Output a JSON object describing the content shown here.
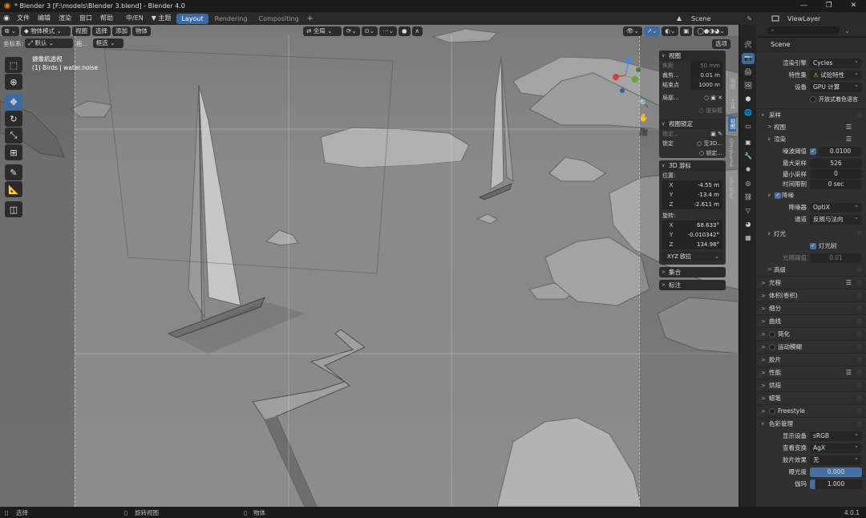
{
  "titlebar": {
    "title": "* Blender 3 [F:\\models\\Blender 3.blend] - Blender 4.0",
    "controls": [
      "—",
      "❐",
      "✕"
    ]
  },
  "menubar": {
    "items": [
      "文件",
      "编辑",
      "渲染",
      "窗口",
      "帮助",
      "中/EN",
      "▼ 主题"
    ],
    "workspaces": [
      "Layout",
      "Rendering",
      "Compositing"
    ],
    "add": "+",
    "scene": "Scene",
    "view_layer": "ViewLayer"
  },
  "viewport": {
    "header": {
      "mode": "物体模式",
      "menus": [
        "视图",
        "选择",
        "添加",
        "物体"
      ],
      "transform": "全局",
      "options": "选项"
    },
    "subheader": {
      "coord_label": "坐标系:",
      "coord_value": "默认",
      "drag_label": "拖...",
      "drag_value": "框选"
    },
    "info_line1": "摄像机透视",
    "info_line2": "(1) Birds | water.noise"
  },
  "npanel": {
    "view": {
      "title": "视图",
      "focal_label": "焦距",
      "focal_value": "50 mm",
      "clip_start_label": "裁剪...",
      "clip_start_value": "0.01 m",
      "clip_end_label": "结束点",
      "clip_end_value": "1000 m",
      "local_label": "局部...",
      "render_region": "渲染框"
    },
    "view_lock": {
      "title": "视图锁定",
      "lock_obj_label": "锁定...",
      "lock_label": "锁定",
      "to_3d": "至3D...",
      "lock2": "锁定..."
    },
    "cursor": {
      "title": "3D 游标",
      "location_label": "位置:",
      "loc": [
        {
          "axis": "X",
          "value": "-4.55 m"
        },
        {
          "axis": "Y",
          "value": "-13.4 m"
        },
        {
          "axis": "Z",
          "value": "-2.611 m"
        }
      ],
      "rotation_label": "旋转:",
      "rot": [
        {
          "axis": "X",
          "value": "68.633°"
        },
        {
          "axis": "Y",
          "value": "-0.010342°"
        },
        {
          "axis": "Z",
          "value": "134.98°"
        }
      ],
      "rotation_mode": "XYZ 欧拉"
    },
    "collections": "集合",
    "annotations": "标注"
  },
  "sidebar_tabs": [
    "视图",
    "工具",
    "视图",
    "Omniverse",
    "GScatter"
  ],
  "properties": {
    "scene_name": "Scene",
    "render_engine_label": "渲染引擎",
    "render_engine": "Cycles",
    "feature_set_label": "特性集",
    "feature_set": "试验特性",
    "device_label": "设备",
    "device": "GPU 计算",
    "osl_label": "开放式着色语言",
    "sampling": "采样",
    "viewport": "视图",
    "render": "渲染",
    "noise_threshold_label": "噪波阈值",
    "noise_threshold": "0.0100",
    "max_samples_label": "最大采样",
    "max_samples": "526",
    "min_samples_label": "最小采样",
    "min_samples": "0",
    "time_limit_label": "时间限制",
    "time_limit": "0 sec",
    "denoise": "降噪",
    "denoiser_label": "降噪器",
    "denoiser": "OptiX",
    "passes_label": "通道",
    "passes": "反照与法向",
    "lights": "灯光",
    "light_tree": "灯光树",
    "light_threshold_label": "光照阈值",
    "light_threshold": "0.01",
    "advanced": "高级",
    "sections": [
      "光程",
      "体积(卷积)",
      "细分",
      "曲线",
      "简化",
      "运动模糊",
      "胶片",
      "性能",
      "烘焙",
      "蜡笔",
      "Freestyle",
      "色彩管理"
    ],
    "display_device_label": "显示设备",
    "display_device": "sRGB",
    "view_transform_label": "查看变换",
    "view_transform": "AgX",
    "look_label": "胶片效果",
    "look": "无",
    "exposure_label": "曝光度",
    "exposure": "0.000",
    "gamma_label": "伽玛",
    "gamma": "1.000"
  },
  "statusbar": {
    "select": "选择",
    "rotate_view": "旋转视图",
    "object": "物体",
    "version": "4.0.1"
  },
  "colors": {
    "accent": "#3d6aa3",
    "blender_orange": "#e87d0d"
  }
}
